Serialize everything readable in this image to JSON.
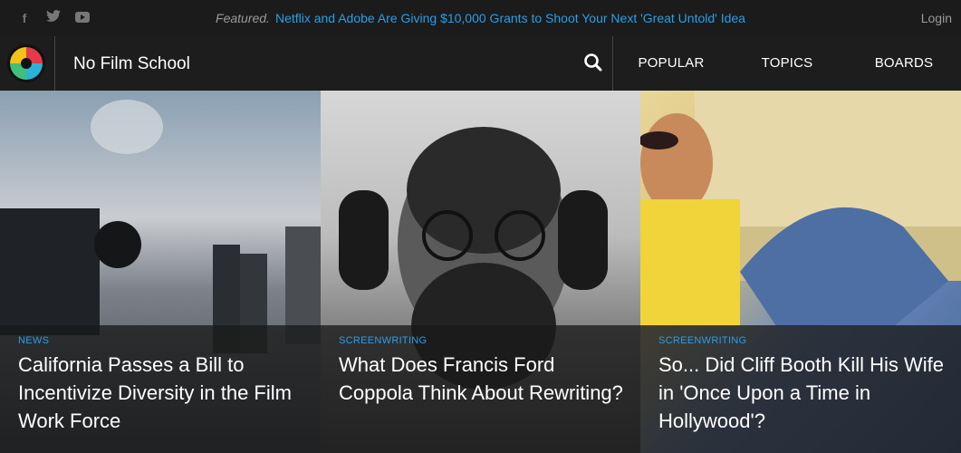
{
  "topbar": {
    "featured_label": "Featured.",
    "featured_link": "Netflix and Adobe Are Giving $10,000 Grants to Shoot Your Next 'Great Untold' Idea",
    "login": "Login",
    "social": [
      "facebook-icon",
      "twitter-icon",
      "youtube-icon"
    ]
  },
  "nav": {
    "brand": "No Film School",
    "items": [
      "POPULAR",
      "TOPICS",
      "BOARDS"
    ]
  },
  "cards": [
    {
      "category": "NEWS",
      "title": "California Passes a Bill to Incentivize Diversity in the Film Work Force"
    },
    {
      "category": "SCREENWRITING",
      "title": "What Does Francis Ford Coppola Think About Rewriting?"
    },
    {
      "category": "SCREENWRITING",
      "title": "So... Did Cliff Booth Kill His Wife in 'Once Upon a Time in Hollywood'?"
    }
  ],
  "colors": {
    "accent": "#2a9ee6",
    "background": "#1b1b1b"
  }
}
